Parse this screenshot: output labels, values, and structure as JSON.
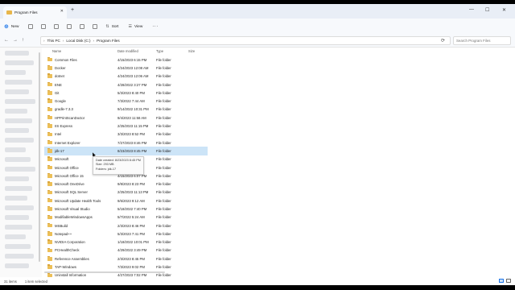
{
  "window": {
    "tab_title": "Program Files",
    "tab_close": "✕",
    "new_tab": "+",
    "controls": [
      "—",
      "☐",
      "✕"
    ]
  },
  "toolbar": {
    "new_label": "New",
    "sort_label": "Sort",
    "view_label": "View",
    "more": "···"
  },
  "nav": {
    "back": "←",
    "forward": "→",
    "up": "↑",
    "refresh": "⟳"
  },
  "breadcrumb": [
    "This PC",
    "Local Disk (C:)",
    "Program Files"
  ],
  "search": {
    "placeholder": "Search Program Files"
  },
  "columns": {
    "name": "Name",
    "date": "Date modified",
    "type": "Type",
    "size": "Size"
  },
  "files": [
    {
      "name": "Common Files",
      "date": "4/15/2023 6:15 PM",
      "type": "File folder"
    },
    {
      "name": "Docker",
      "date": "4/24/2023 12:08 AM",
      "type": "File folder"
    },
    {
      "name": "dotnet",
      "date": "4/24/2023 12:06 AM",
      "type": "File folder"
    },
    {
      "name": "ENE",
      "date": "4/28/2022 3:27 PM",
      "type": "File folder"
    },
    {
      "name": "Git",
      "date": "5/3/2023 8:40 PM",
      "type": "File folder"
    },
    {
      "name": "Google",
      "date": "7/3/2022 7:44 AM",
      "type": "File folder"
    },
    {
      "name": "gradle-7.3.3",
      "date": "9/14/2022 10:31 PM",
      "type": "File folder"
    },
    {
      "name": "HPPrintScanDoctor",
      "date": "9/4/2023 11:58 AM",
      "type": "File folder"
    },
    {
      "name": "IIS Express",
      "date": "2/25/2023 11:15 PM",
      "type": "File folder"
    },
    {
      "name": "Intel",
      "date": "3/3/2023 8:52 PM",
      "type": "File folder"
    },
    {
      "name": "Internet Explorer",
      "date": "7/27/2023 8:46 PM",
      "type": "File folder"
    },
    {
      "name": "jdk-17",
      "date": "8/23/2023 8:45 PM",
      "type": "File folder",
      "selected": true
    },
    {
      "name": "Microsoft",
      "date": "",
      "type": "File folder"
    },
    {
      "name": "Microsoft Office",
      "date": "",
      "type": "File folder"
    },
    {
      "name": "Microsoft Office 15",
      "date": "4/15/2023 6:07 PM",
      "type": "File folder"
    },
    {
      "name": "Microsoft OneDrive",
      "date": "9/8/2023 8:23 PM",
      "type": "File folder"
    },
    {
      "name": "Microsoft SQL Server",
      "date": "2/25/2023 11:13 PM",
      "type": "File folder"
    },
    {
      "name": "Microsoft Update Health Tools",
      "date": "9/6/2023 9:12 AM",
      "type": "File folder"
    },
    {
      "name": "Microsoft Visual Studio",
      "date": "5/18/2022 7:40 PM",
      "type": "File folder"
    },
    {
      "name": "ModifiableWindowsApps",
      "date": "5/7/2022 5:24 AM",
      "type": "File folder"
    },
    {
      "name": "MSBuild",
      "date": "2/3/2023 8:46 PM",
      "type": "File folder"
    },
    {
      "name": "Notepad++",
      "date": "5/3/2023 7:41 PM",
      "type": "File folder"
    },
    {
      "name": "NVIDIA Corporation",
      "date": "1/18/2022 10:01 PM",
      "type": "File folder"
    },
    {
      "name": "PCHealthCheck",
      "date": "4/29/2022 3:49 PM",
      "type": "File folder"
    },
    {
      "name": "Reference Assemblies",
      "date": "2/3/2023 8:45 PM",
      "type": "File folder"
    },
    {
      "name": "TAP-Windows",
      "date": "7/3/2023 9:02 PM",
      "type": "File folder"
    },
    {
      "name": "Uninstall Information",
      "date": "4/27/2023 7:02 PM",
      "type": "File folder"
    }
  ],
  "tooltip": {
    "line1": "Date created: 8/23/2023 8:45 PM",
    "line2": "Size: 293 MB",
    "line3": "Folders: jdk-17"
  },
  "status": {
    "items": "31 items",
    "selected": "1 item selected"
  }
}
